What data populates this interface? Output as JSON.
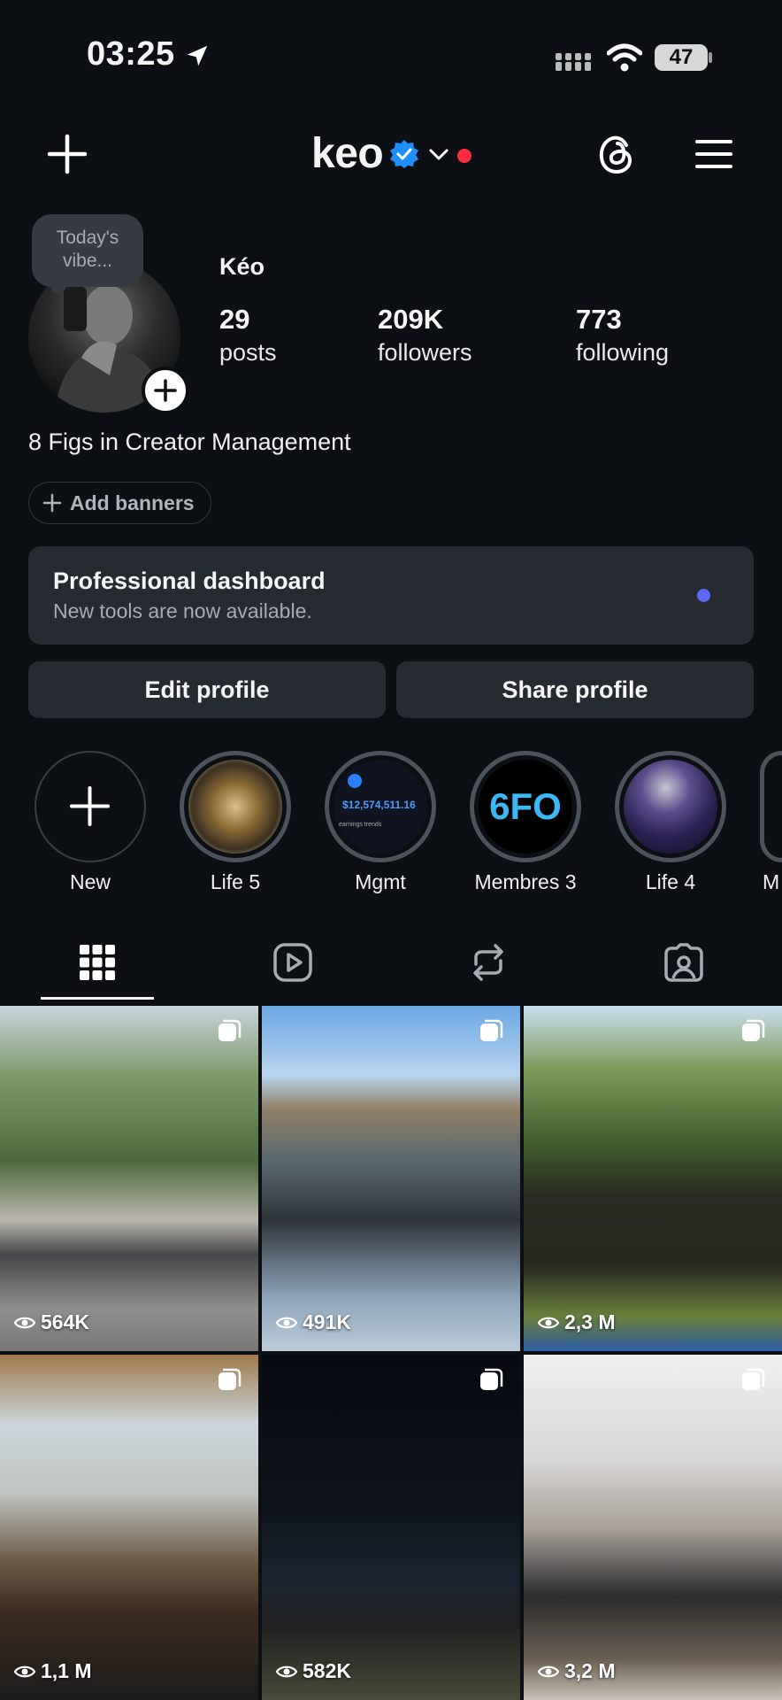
{
  "status_bar": {
    "time": "03:25",
    "battery": "47"
  },
  "header": {
    "username": "keo"
  },
  "note": {
    "text": "Today's vibe..."
  },
  "profile": {
    "display_name": "Kéo",
    "stats": [
      {
        "value": "29",
        "label": "posts"
      },
      {
        "value": "209K",
        "label": "followers"
      },
      {
        "value": "773",
        "label": "following"
      }
    ],
    "bio": "8 Figs in Creator Management",
    "add_banners_label": "Add banners"
  },
  "dashboard": {
    "title": "Professional dashboard",
    "subtitle": "New tools are now available."
  },
  "buttons": {
    "edit": "Edit profile",
    "share": "Share profile"
  },
  "highlights": [
    {
      "label": "New"
    },
    {
      "label": "Life 5"
    },
    {
      "label": "Mgmt"
    },
    {
      "label": "Membres 3"
    },
    {
      "label": "Life 4"
    },
    {
      "label": "M"
    }
  ],
  "highlight_text": {
    "mgmt_amount": "$12,574,511.16",
    "mgmt_caption": "earnings trends",
    "membres_logo": "6FO"
  },
  "posts": [
    {
      "views": "564K"
    },
    {
      "views": "491K"
    },
    {
      "views": "2,3 M"
    },
    {
      "views": "1,1 M"
    },
    {
      "views": "582K"
    },
    {
      "views": "3,2 M"
    }
  ],
  "colors": {
    "background": "#0c1014",
    "card": "#262a31",
    "verified": "#1f8fff",
    "dot_red": "#ff2d3f",
    "dot_blue": "#5d69f5"
  }
}
